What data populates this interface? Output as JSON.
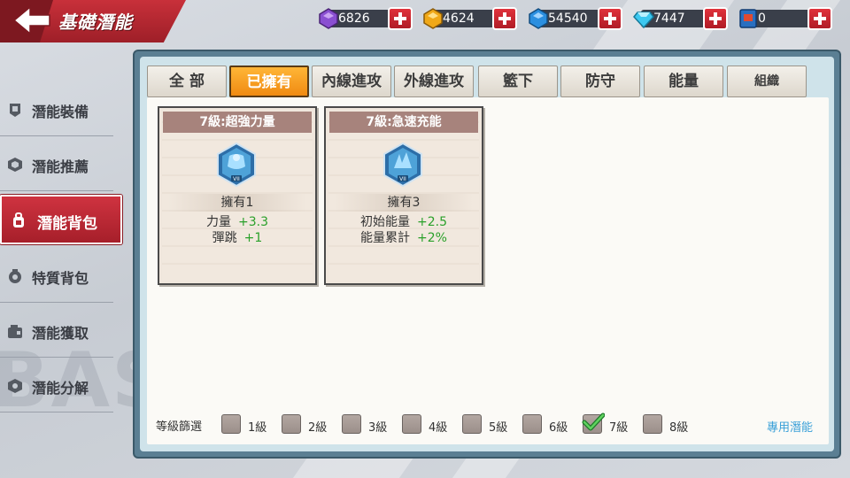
{
  "header": {
    "title": "基礎潛能",
    "back_icon": "back-arrow-icon"
  },
  "currencies": [
    {
      "name": "purple-gem",
      "value": "6826",
      "color": "#8a4fd1"
    },
    {
      "name": "gold-gem",
      "value": "4624",
      "color": "#f0a818"
    },
    {
      "name": "blue-gem",
      "value": "54540",
      "color": "#2b8fe0"
    },
    {
      "name": "diamond",
      "value": "7447",
      "color": "#3cc8f0"
    },
    {
      "name": "ticket",
      "value": "0",
      "color": "#2a6fc0"
    }
  ],
  "sidebar": {
    "items": [
      {
        "label": "潛能裝備",
        "icon": "potential-equip-icon"
      },
      {
        "label": "潛能推薦",
        "icon": "potential-recommend-icon"
      },
      {
        "label": "潛能背包",
        "icon": "potential-bag-icon",
        "active": true
      },
      {
        "label": "特質背包",
        "icon": "trait-bag-icon"
      },
      {
        "label": "潛能獲取",
        "icon": "potential-obtain-icon"
      },
      {
        "label": "潛能分解",
        "icon": "potential-decompose-icon"
      }
    ]
  },
  "background_text": "BASI",
  "tabs": [
    {
      "label": "全 部"
    },
    {
      "label": "已擁有",
      "active": true
    },
    {
      "label": "內線進攻"
    },
    {
      "label": "外線進攻"
    },
    {
      "label": "籃下"
    },
    {
      "label": "防守"
    },
    {
      "label": "能量"
    },
    {
      "label": "組織"
    }
  ],
  "cards": [
    {
      "title": "7級:超強力量",
      "owned": "擁有1",
      "emblem": "strength-emblem-icon",
      "stats": [
        {
          "name": "力量",
          "value": "+3.3"
        },
        {
          "name": "彈跳",
          "value": "+1"
        }
      ]
    },
    {
      "title": "7級:急速充能",
      "owned": "擁有3",
      "emblem": "recharge-emblem-icon",
      "stats": [
        {
          "name": "初始能量",
          "value": "+2.5"
        },
        {
          "name": "能量累計",
          "value": "+2%"
        }
      ]
    }
  ],
  "filter": {
    "label": "等級篩選",
    "levels": [
      {
        "label": "1級",
        "checked": false
      },
      {
        "label": "2級",
        "checked": false
      },
      {
        "label": "3級",
        "checked": false
      },
      {
        "label": "4級",
        "checked": false
      },
      {
        "label": "5級",
        "checked": false
      },
      {
        "label": "6級",
        "checked": false
      },
      {
        "label": "7級",
        "checked": true
      },
      {
        "label": "8級",
        "checked": false
      }
    ],
    "exclusive_link": "專用潛能"
  }
}
